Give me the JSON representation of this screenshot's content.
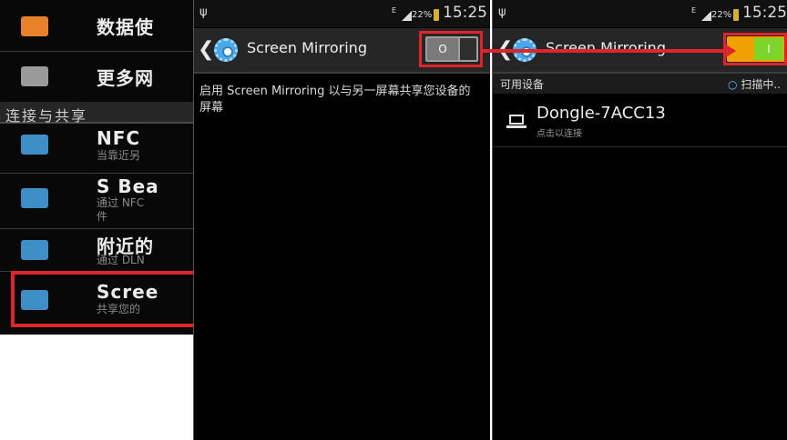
{
  "settings_list": {
    "items": [
      {
        "icon": "data-usage-icon",
        "title": "数据使",
        "subtitle": ""
      },
      {
        "icon": "more-networks-icon",
        "title": "更多网",
        "subtitle": ""
      },
      {
        "icon": "nfc-icon",
        "title": "NFC",
        "subtitle": "当靠近另"
      },
      {
        "icon": "s-beam-icon",
        "title": "S Bea",
        "subtitle": "通过 NFC",
        "subtitle2": "件"
      },
      {
        "icon": "nearby-devices-icon",
        "title": "附近的",
        "subtitle": "通过 DLN"
      },
      {
        "icon": "screen-mirroring-icon",
        "title": "Scree",
        "subtitle": "共享您的"
      }
    ],
    "section_header": "连接与共享"
  },
  "status_bar": {
    "usb_icon": "usb-icon",
    "network_type": "E",
    "battery_percent": "22%",
    "time": "15:25"
  },
  "panel_off": {
    "title": "Screen Mirroring",
    "toggle_label": "O",
    "description": "启用 Screen Mirroring 以与另一屏幕共享您设备的屏幕"
  },
  "panel_on": {
    "title": "Screen Mirroring",
    "toggle_label": "I",
    "available_devices_label": "可用设备",
    "scanning_label": "扫描中..",
    "device": {
      "name": "Dongle-7ACC13",
      "hint": "点击以连接"
    }
  },
  "colors": {
    "highlight": "#e0242b",
    "toggle_on_track": "#f0a000",
    "toggle_on_knob": "#7fd42a",
    "toggle_off_track": "#9e9e9e",
    "settings_icon_blue": "#4aa8e8"
  }
}
